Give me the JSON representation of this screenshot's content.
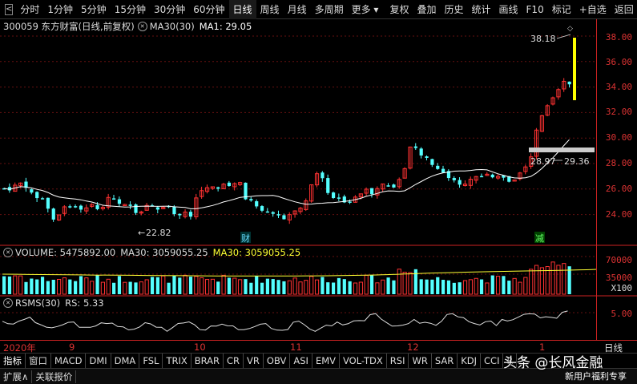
{
  "toolbar": {
    "toggle": "<",
    "items": [
      "分时",
      "1分钟",
      "5分钟",
      "15分钟",
      "30分钟",
      "60分钟",
      "日线",
      "周线",
      "月线",
      "多周期",
      "更多"
    ],
    "active_index": 6,
    "right_items": [
      "复权",
      "叠加",
      "历史",
      "统计",
      "画线",
      "F10",
      "标记",
      "+自选",
      "返回"
    ]
  },
  "main_panel": {
    "stock": "300059 东方财富(日线,前复权)",
    "indicator": "MA30(30)",
    "ma1": "MA1: 29.05",
    "high_label": "38.18",
    "low_label": "22.82",
    "range_label_left": "28.97",
    "range_label_right": "29.36",
    "marker_cai": "财",
    "marker_jian": "减"
  },
  "volume_panel": {
    "title": "VOLUME: 5475892.00",
    "ma30": "MA30: 3059055.25",
    "ma30b": "MA30: 3059055.25",
    "scale": "X100"
  },
  "rsms_panel": {
    "title": "RSMS(30)",
    "rs": "RS: 5.33"
  },
  "yaxis": {
    "price": [
      "38.00",
      "36.00",
      "34.00",
      "32.00",
      "30.00",
      "28.00",
      "26.00",
      "24.00"
    ],
    "volume": [
      "70000",
      "35000"
    ],
    "rs": [
      "5.00"
    ]
  },
  "dates": [
    "2020年",
    "9",
    "10",
    "11",
    "12",
    "1"
  ],
  "dates_right": "日线",
  "tabs": [
    "指标",
    "窗口",
    "MACD",
    "DMI",
    "DMA",
    "FSL",
    "TRIX",
    "BRAR",
    "CR",
    "VR",
    "OBV",
    "ASI",
    "EMV",
    "VOL-TDX",
    "RSI",
    "WR",
    "SAR",
    "KDJ",
    "CCI",
    "R"
  ],
  "bottom": [
    "扩展∧",
    "关联报价"
  ],
  "watermark": "头条 @长风金融",
  "watermark2": "新用户福利专享",
  "colors": {
    "up": "#ff3232",
    "down": "#54ffff",
    "ma": "#ffffff",
    "axis": "#c22222",
    "highlight": "#ffff00"
  }
}
